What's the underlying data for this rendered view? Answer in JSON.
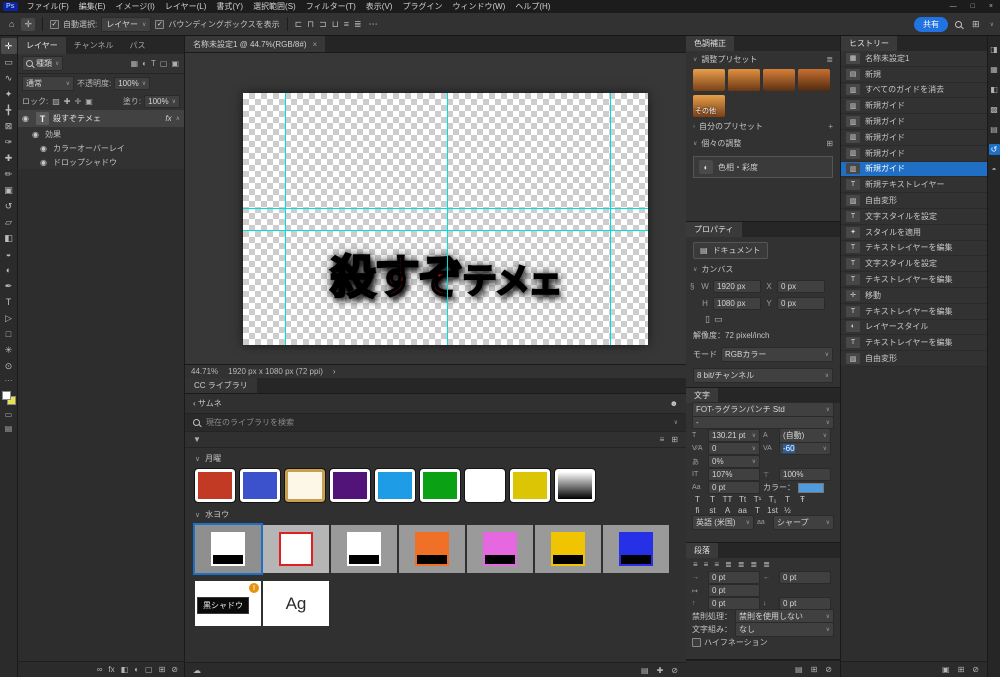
{
  "icons": {
    "ps": "Ps",
    "home": "⌂",
    "move": "✛",
    "check": "✓",
    "chev_down": "∨",
    "chev_up": "∧",
    "chev_right": "›",
    "chev_left": "‹",
    "more": "⋯",
    "workspace": "⊞",
    "menu": "≣",
    "plus": "+",
    "eye": "◉",
    "avatar": "☻",
    "funnel": "▼",
    "list_view": "≡",
    "grid_view": "⊞",
    "cloud": "☁",
    "add": "✚",
    "trash": "⊘",
    "chain": "§",
    "portrait": "▯",
    "landscape": "▭",
    "doc": "▤",
    "fx": "fx",
    "mask": "◧",
    "adjust": "◐",
    "group": "▢",
    "link": "∞",
    "snapshot": "▣",
    "t_size": "T",
    "t_leading": "A",
    "t_kern": "V⁄A",
    "t_track": "VA",
    "t_tsume": "あ",
    "t_vscale": "IT",
    "t_hscale": "⊤",
    "t_baseline": "Aa",
    "t_aa": "aa",
    "indent_left": "→",
    "indent_right": "←",
    "indent_first": "↦",
    "space_before": "↑",
    "space_after": "↓"
  },
  "titlebar": {
    "logo": "Ps",
    "menus": [
      "ファイル(F)",
      "編集(E)",
      "イメージ(I)",
      "レイヤー(L)",
      "書式(Y)",
      "選択範囲(S)",
      "フィルター(T)",
      "表示(V)",
      "プラグイン",
      "ウィンドウ(W)",
      "ヘルプ(H)"
    ],
    "window_controls": [
      "—",
      "□",
      "×"
    ]
  },
  "optionsbar": {
    "auto_select_label": "自動選択:",
    "auto_select_value": "レイヤー",
    "bbox_label": "バウンディングボックスを表示",
    "share_label": "共有",
    "align_icons": [
      {
        "name": "align-left-icon",
        "glyph": "⊏"
      },
      {
        "name": "align-center-h-icon",
        "glyph": "⊓"
      },
      {
        "name": "align-right-icon",
        "glyph": "⊐"
      },
      {
        "name": "align-bottom-icon",
        "glyph": "⊔"
      },
      {
        "name": "distribute-h-icon",
        "glyph": "≡"
      },
      {
        "name": "distribute-v-icon",
        "glyph": "≣"
      }
    ]
  },
  "toolbar": {
    "tools": [
      {
        "name": "move-tool",
        "glyph": "✛",
        "active": true
      },
      {
        "name": "marquee-tool",
        "glyph": "▭"
      },
      {
        "name": "lasso-tool",
        "glyph": "∿"
      },
      {
        "name": "quick-selection-tool",
        "glyph": "✦"
      },
      {
        "name": "crop-tool",
        "glyph": "╋"
      },
      {
        "name": "frame-tool",
        "glyph": "⊠"
      },
      {
        "name": "eyedropper-tool",
        "glyph": "✑"
      },
      {
        "name": "healing-brush-tool",
        "glyph": "✚"
      },
      {
        "name": "brush-tool",
        "glyph": "✏"
      },
      {
        "name": "clone-stamp-tool",
        "glyph": "▣"
      },
      {
        "name": "history-brush-tool",
        "glyph": "↺"
      },
      {
        "name": "eraser-tool",
        "glyph": "▱"
      },
      {
        "name": "gradient-tool",
        "glyph": "◧"
      },
      {
        "name": "blur-tool",
        "glyph": "◒"
      },
      {
        "name": "dodge-tool",
        "glyph": "◐"
      },
      {
        "name": "pen-tool",
        "glyph": "✒"
      },
      {
        "name": "type-tool",
        "glyph": "T"
      },
      {
        "name": "path-selection-tool",
        "glyph": "▷"
      },
      {
        "name": "shape-tool",
        "glyph": "□"
      },
      {
        "name": "hand-tool",
        "glyph": "✳"
      },
      {
        "name": "zoom-tool",
        "glyph": "⊙"
      }
    ]
  },
  "layers_panel": {
    "tabs": [
      {
        "label": "レイヤー",
        "active": true
      },
      {
        "label": "チャンネル"
      },
      {
        "label": "パス"
      }
    ],
    "filter_label": "種類",
    "filter_icons": [
      {
        "name": "filter-pixel-icon",
        "glyph": "▦"
      },
      {
        "name": "filter-adjustment-icon",
        "glyph": "◐"
      },
      {
        "name": "filter-type-icon",
        "glyph": "T"
      },
      {
        "name": "filter-shape-icon",
        "glyph": "▢"
      },
      {
        "name": "filter-smart-icon",
        "glyph": "▣"
      }
    ],
    "blend_mode": "通常",
    "opacity_label": "不透明度:",
    "opacity_value": "100%",
    "lock_label": "ロック:",
    "lock_icons": [
      {
        "name": "lock-transparency-icon",
        "glyph": "▨"
      },
      {
        "name": "lock-pixels-icon",
        "glyph": "✚"
      },
      {
        "name": "lock-position-icon",
        "glyph": "✛"
      },
      {
        "name": "lock-all-icon",
        "glyph": "▣"
      }
    ],
    "fill_label": "塗り:",
    "fill_value": "100%",
    "layer": {
      "type_badge": "T",
      "name": "殺すぞテメェ",
      "fx": "fx"
    },
    "effects_label": "効果",
    "effects": [
      "カラーオーバーレイ",
      "ドロップシャドウ"
    ],
    "bottom_icons": [
      {
        "name": "link-layers-icon",
        "glyph": "∞"
      },
      {
        "name": "layer-style-icon",
        "glyph": "fx"
      },
      {
        "name": "layer-mask-icon",
        "glyph": "◧"
      },
      {
        "name": "adjustment-layer-icon",
        "glyph": "◐"
      },
      {
        "name": "layer-group-icon",
        "glyph": "▢"
      },
      {
        "name": "new-layer-icon",
        "glyph": "⊞"
      },
      {
        "name": "delete-layer-icon",
        "glyph": "⊘"
      }
    ]
  },
  "document": {
    "tab_title": "名称未設定1 @ 44.7%(RGB/8#)",
    "close": "×",
    "zoom": "44.71%",
    "dimensions": "1920 px x 1080 px (72 ppi)",
    "canvas_text_main": "殺すぞ",
    "canvas_text_sub": "テメェ",
    "text_fill": "#ea1309",
    "guides_v": [
      "10.4%",
      "50.4%",
      "90.6%"
    ],
    "guides_h": [
      "45.6%",
      "54.4%"
    ]
  },
  "cc_library": {
    "tab": "CC ライブラリ",
    "back_label": "サムネ",
    "search_placeholder": "現在のライブラリを検索",
    "section1": "月曜",
    "swatches1": [
      {
        "bg": "#c23a24"
      },
      {
        "bg": "#3c52cc"
      },
      {
        "bg": "#fdf7e8",
        "ring": "#c8a050"
      },
      {
        "bg": "#521478"
      },
      {
        "bg": "#1e9ce6"
      },
      {
        "bg": "#0aa214"
      },
      {
        "bg": "#ffffff"
      },
      {
        "bg": "#dcc504"
      },
      {
        "bg": "linear-gradient(180deg,#ffffff 0%,#000000 100%)"
      }
    ],
    "section2": "水ヨウ",
    "tiles2": [
      {
        "tile": "#8f8f8f",
        "swatch": "#ffffff",
        "bar": "#000000",
        "selected": true
      },
      {
        "tile": "#b5b5b5",
        "swatch": "#ffffff",
        "ring": "#e02020"
      },
      {
        "tile": "#9a9a9a",
        "swatch": "#ffffff",
        "bar": "#000000"
      },
      {
        "tile": "#9a9a9a",
        "swatch": "#f07028",
        "bar": "#000000"
      },
      {
        "tile": "#9a9a9a",
        "swatch": "#e668e0",
        "bar": "#000000"
      },
      {
        "tile": "#9a9a9a",
        "swatch": "#f0c400",
        "bar": "#000000"
      },
      {
        "tile": "#9a9a9a",
        "swatch": "#2630e6",
        "bar": "#000000"
      }
    ],
    "tooltip": "黒シャドウ",
    "char_styles": [
      {
        "label": "Ag",
        "badge": "!"
      },
      {
        "label": "Ag"
      }
    ]
  },
  "adjustments": {
    "tab": "色調補正",
    "presets_label": "調整プリセット",
    "presets": [
      {
        "bg": "linear-gradient(180deg,#e8a04a,#7a4018)"
      },
      {
        "bg": "linear-gradient(180deg,#e09040,#6a3814)"
      },
      {
        "bg": "linear-gradient(180deg,#d88038,#5c3012)"
      },
      {
        "bg": "linear-gradient(180deg,#c87030,#502a10)"
      }
    ],
    "more_label": "その他",
    "more_bg": "linear-gradient(180deg,#e8a04a,#7a4018)",
    "my_presets_label": "自分のプリセット",
    "individual_label": "個々の調整",
    "hue_sat_label": "色相・彩度"
  },
  "properties": {
    "tab": "プロパティ",
    "doc_label": "ドキュメント",
    "canvas_label": "カンバス",
    "w_label": "W",
    "w_value": "1920 px",
    "h_label": "H",
    "h_value": "1080 px",
    "x_label": "X",
    "x_value": "0 px",
    "y_label": "Y",
    "y_value": "0 px",
    "resolution": "解像度：72 pixel/inch",
    "mode_label": "モード",
    "mode_value": "RGBカラー",
    "depth_value": "8 bit/チャンネル"
  },
  "character": {
    "tab": "文字",
    "font_name": "FOT-ラグランパンチ Std",
    "font_style": "-",
    "size_value": "130.21 pt",
    "leading_value": "(自動)",
    "kerning_value": "0",
    "tracking_value": "-60",
    "tsume_value": "0%",
    "v_scale_value": "107%",
    "h_scale_value": "100%",
    "baseline_value": "0 pt",
    "color_label": "カラー：",
    "color_value": "#4f9bdc",
    "format_buttons": [
      "T",
      "T",
      "TT",
      "Tt",
      "T¹",
      "T₁",
      "T",
      "Ŧ"
    ],
    "ot_buttons": [
      "fi",
      "st",
      "A",
      "aa",
      "T",
      "1st",
      "½"
    ],
    "language_value": "英語 (米国)",
    "antialias_value": "シャープ"
  },
  "paragraph": {
    "tab": "段落",
    "align_buttons": [
      {
        "name": "align-text-left-icon",
        "glyph": "≡"
      },
      {
        "name": "align-text-center-icon",
        "glyph": "≡"
      },
      {
        "name": "align-text-right-icon",
        "glyph": "≡"
      },
      {
        "name": "justify-last-left-icon",
        "glyph": "≣"
      },
      {
        "name": "justify-last-center-icon",
        "glyph": "≣"
      },
      {
        "name": "justify-last-right-icon",
        "glyph": "≣"
      },
      {
        "name": "justify-all-icon",
        "glyph": "≣"
      }
    ],
    "indent_left": "0 pt",
    "indent_right": "0 pt",
    "indent_first": "0 pt",
    "space_before": "0 pt",
    "space_after": "0 pt",
    "kinsoku_label": "禁則処理：",
    "kinsoku_value": "禁則を使用しない",
    "mojikumi_label": "文字組み：",
    "mojikumi_value": "なし",
    "hyphenate_label": "ハイフネーション"
  },
  "history": {
    "tab": "ヒストリー",
    "items": [
      {
        "label": "名称未設定1",
        "glyph": "▦"
      },
      {
        "label": "新規",
        "glyph": "▤"
      },
      {
        "label": "すべてのガイドを消去",
        "glyph": "▥"
      },
      {
        "label": "新規ガイド",
        "glyph": "▥"
      },
      {
        "label": "新規ガイド",
        "glyph": "▥"
      },
      {
        "label": "新規ガイド",
        "glyph": "▥"
      },
      {
        "label": "新規ガイド",
        "glyph": "▥"
      },
      {
        "label": "新規ガイド",
        "glyph": "▥",
        "selected": true
      },
      {
        "label": "新規テキストレイヤー",
        "glyph": "T"
      },
      {
        "label": "自由変形",
        "glyph": "▧"
      },
      {
        "label": "文字スタイルを設定",
        "glyph": "T"
      },
      {
        "label": "スタイルを適用",
        "glyph": "✦"
      },
      {
        "label": "テキストレイヤーを編集",
        "glyph": "T"
      },
      {
        "label": "文字スタイルを設定",
        "glyph": "T"
      },
      {
        "label": "テキストレイヤーを編集",
        "glyph": "T"
      },
      {
        "label": "移動",
        "glyph": "✛"
      },
      {
        "label": "テキストレイヤーを編集",
        "glyph": "T"
      },
      {
        "label": "レイヤースタイル",
        "glyph": "◐"
      },
      {
        "label": "テキストレイヤーを編集",
        "glyph": "T"
      },
      {
        "label": "自由変形",
        "glyph": "▧"
      }
    ]
  },
  "edge_strip": {
    "icons": [
      {
        "name": "color-panel-icon",
        "glyph": "◨"
      },
      {
        "name": "swatches-panel-icon",
        "glyph": "▦"
      },
      {
        "name": "gradients-panel-icon",
        "glyph": "◧"
      },
      {
        "name": "patterns-panel-icon",
        "glyph": "▩"
      },
      {
        "name": "libraries-panel-icon",
        "glyph": "▤"
      },
      {
        "name": "history-panel-icon",
        "glyph": "↺",
        "selected": true
      },
      {
        "name": "navigator-panel-icon",
        "glyph": "◓"
      }
    ]
  }
}
